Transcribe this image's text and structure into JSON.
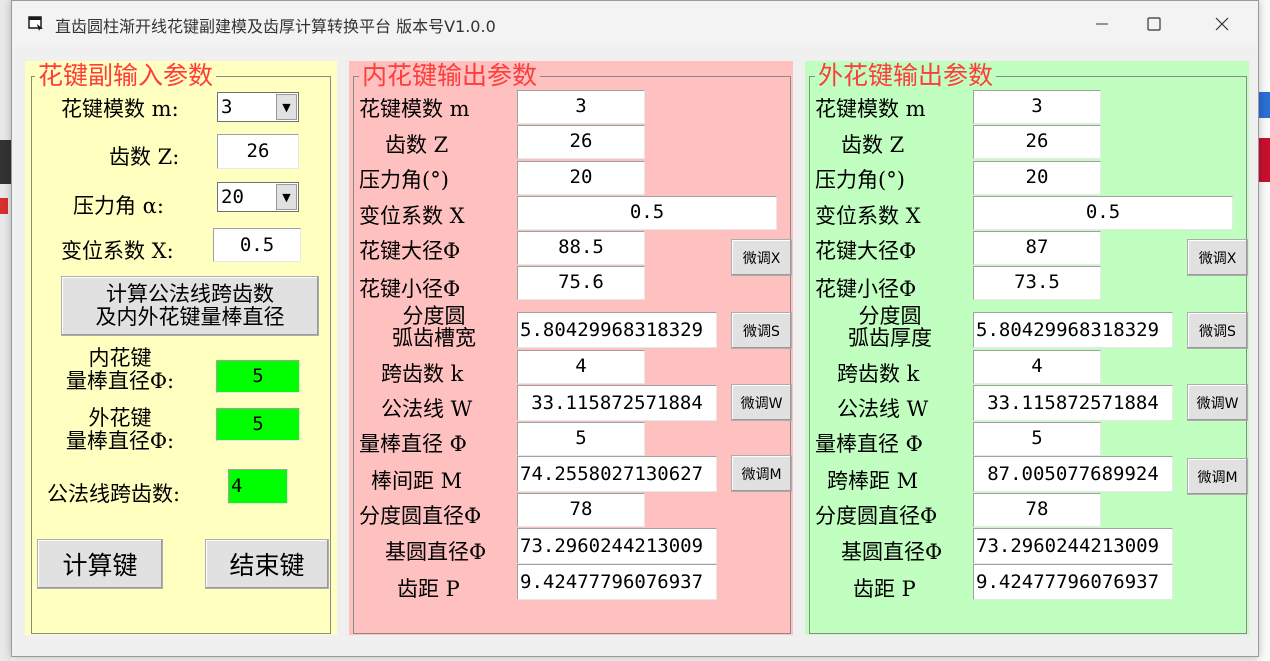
{
  "window": {
    "title": "直齿圆柱渐开线花键副建模及齿厚计算转换平台  版本号V1.0.0",
    "minimize_icon": "minimize-icon",
    "maximize_icon": "maximize-icon",
    "close_icon": "close-icon"
  },
  "colors": {
    "input_panel_bg": "#ffffc0",
    "inner_panel_bg": "#ffc0c0",
    "outer_panel_bg": "#c0ffc0",
    "legend_text": "#ff3c3c",
    "highlight_field": "#00ff00"
  },
  "input": {
    "legend": "花键副输入参数",
    "module_label": "花键模数 m:",
    "module_value": "3",
    "teeth_label": "齿数 Z:",
    "teeth_value": "26",
    "pressure_label": "压力角 α:",
    "pressure_value": "20",
    "shift_label": "变位系数 X:",
    "shift_value": "0.5",
    "calc_button_line1": "计算公法线跨齿数",
    "calc_button_line2": "及内外花键量棒直径",
    "inner_pin_label_line1": "内花键",
    "inner_pin_label_line2": "量棒直径Φ:",
    "inner_pin_value": "5",
    "outer_pin_label_line1": "外花键",
    "outer_pin_label_line2": "量棒直径Φ:",
    "outer_pin_value": "5",
    "span_label": "公法线跨齿数:",
    "span_value": "4",
    "compute_button": "计算键",
    "exit_button": "结束键"
  },
  "inner": {
    "legend": "内花键输出参数",
    "module_label": "花键模数 m",
    "module_value": "3",
    "teeth_label": "齿数  Z",
    "teeth_value": "26",
    "pressure_label": "压力角(°)",
    "pressure_value": "20",
    "shift_label": "变位系数 X",
    "shift_value": "0.5",
    "major_label": "花键大径Φ",
    "major_value": "88.5",
    "minor_label": "花键小径Φ",
    "minor_value": "75.6",
    "arc_label_line1": "分度圆",
    "arc_label_line2": "弧齿槽宽",
    "arc_value": "5.80429968318329",
    "span_label": "跨齿数 k",
    "span_value": "4",
    "w_label": "公法线 W",
    "w_value": "33.115872571884",
    "pin_label": "量棒直径 Φ",
    "pin_value": "5",
    "m_label": "棒间距 M",
    "m_value": "74.2558027130627",
    "pitch_dia_label": "分度圆直径Φ",
    "pitch_dia_value": "78",
    "base_dia_label": "基圆直径Φ",
    "base_dia_value": "73.2960244213009",
    "pitch_label": "齿距 P",
    "pitch_value": "9.42477796076937",
    "adj_x": "微调X",
    "adj_s": "微调S",
    "adj_w": "微调W",
    "adj_m": "微调M"
  },
  "outer": {
    "legend": "外花键输出参数",
    "module_label": "花键模数 m",
    "module_value": "3",
    "teeth_label": "齿数  Z",
    "teeth_value": "26",
    "pressure_label": "压力角(°)",
    "pressure_value": "20",
    "shift_label": "变位系数 X",
    "shift_value": "0.5",
    "major_label": "花键大径Φ",
    "major_value": "87",
    "minor_label": "花键小径Φ",
    "minor_value": "73.5",
    "arc_label_line1": "分度圆",
    "arc_label_line2": "弧齿厚度",
    "arc_value": "5.80429968318329",
    "span_label": "跨齿数 k",
    "span_value": "4",
    "w_label": "公法线 W",
    "w_value": "33.115872571884",
    "pin_label": "量棒直径 Φ",
    "pin_value": "5",
    "m_label": "跨棒距 M",
    "m_value": "87.005077689924",
    "pitch_dia_label": "分度圆直径Φ",
    "pitch_dia_value": "78",
    "base_dia_label": "基圆直径Φ",
    "base_dia_value": "73.2960244213009",
    "pitch_label": "齿距 P",
    "pitch_value": "9.42477796076937",
    "adj_x": "微调X",
    "adj_s": "微调S",
    "adj_w": "微调W",
    "adj_m": "微调M"
  }
}
